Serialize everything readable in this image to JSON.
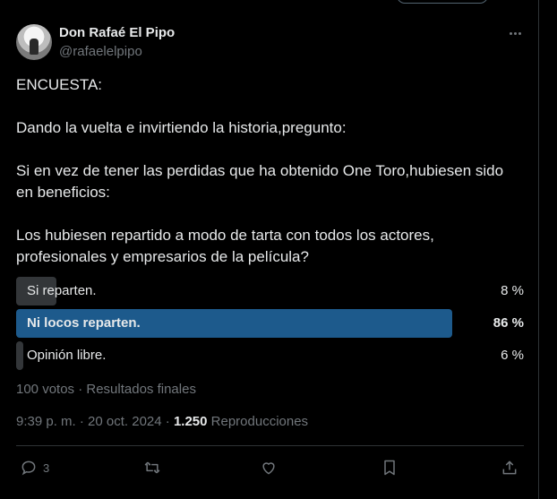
{
  "author": {
    "display_name": "Don Rafaé El Pipo",
    "handle": "@rafaelelpipo"
  },
  "tweet": {
    "text": "ENCUESTA:\n\nDando la vuelta e invirtiendo la historia,pregunto:\n\nSi en vez de tener las perdidas que ha obtenido One Toro,hubiesen sido en beneficios:\n\nLos hubiesen repartido a modo de tarta con todos los actores, profesionales y empresarios de la película?"
  },
  "poll": {
    "options": [
      {
        "label": "Si reparten.",
        "percent": "8 %",
        "value": 8,
        "winner": false
      },
      {
        "label": "Ni locos reparten.",
        "percent": "86 %",
        "value": 86,
        "winner": true
      },
      {
        "label": "Opinión libre.",
        "percent": "6 %",
        "value": 6,
        "winner": false
      }
    ],
    "meta": "100 votos · Resultados finales"
  },
  "timestamp": "9:39 p. m. · 20 oct. 2024 · ",
  "views_count": "1.250",
  "views_label": " Reproducciones",
  "actions": {
    "reply_count": "3"
  },
  "colors": {
    "background": "#000000",
    "winner_bar": "#1d5a8c",
    "bar": "#333639",
    "muted_text": "#71767b"
  }
}
